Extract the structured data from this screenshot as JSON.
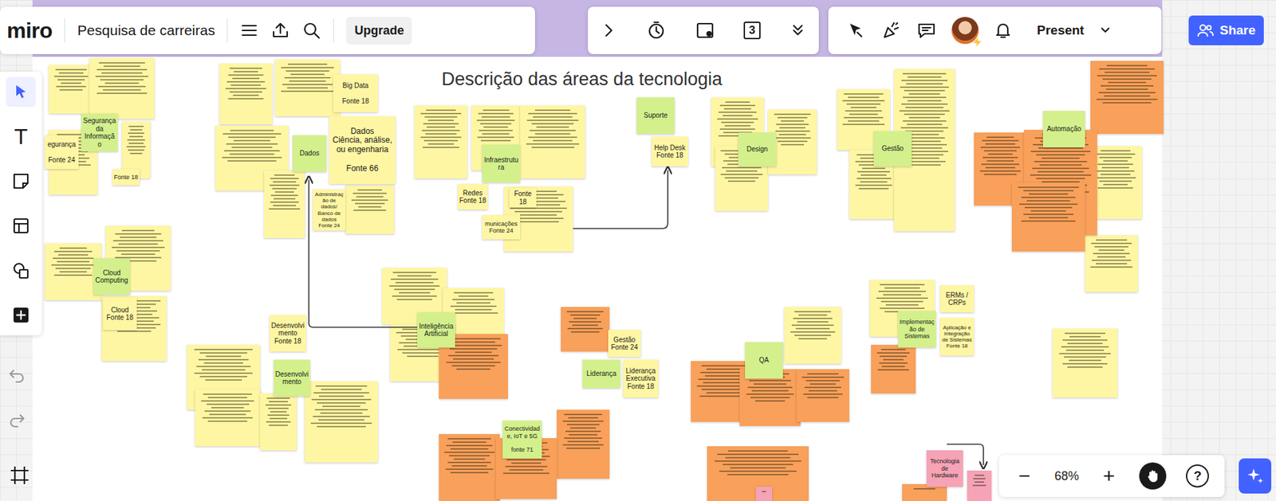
{
  "toolbar": {
    "logo": "miro",
    "board_title": "Pesquisa de carreiras",
    "upgrade": "Upgrade",
    "counter": "3",
    "present": "Present",
    "share": "Share",
    "text_tool": "T"
  },
  "frame": {
    "heading": "Descrição das áreas da tecnologia"
  },
  "notes": [
    {
      "text": "Segurança da Informação",
      "color": "#d3f08c"
    },
    {
      "text": "egurança\n\nFonte 24",
      "color": "#fff6a3"
    },
    {
      "text": "Fonte 18",
      "color": "#fff6a3"
    },
    {
      "text": "Big Data\n\nFonte 18",
      "color": "#fff6a3"
    },
    {
      "text": "Dados\nCiência, análise, ou engenharia\n\nFonte 66",
      "color": "#fff6a3"
    },
    {
      "text": "Dados",
      "color": "#d3f08c"
    },
    {
      "text": "Administração de dados/ Banco de dados\nFonte 24",
      "color": "#fff6a3"
    },
    {
      "text": "Infraestrutura",
      "color": "#d3f08c"
    },
    {
      "text": "Redes\nFonte 18",
      "color": "#fff6a3"
    },
    {
      "text": "Fonte 18",
      "color": "#fff6a3"
    },
    {
      "text": "municações\nFonte 24",
      "color": "#fff6a3"
    },
    {
      "text": "Suporte",
      "color": "#d3f08c"
    },
    {
      "text": "Help Desk\nFonte 18",
      "color": "#fff6a3"
    },
    {
      "text": "Design",
      "color": "#d3f08c"
    },
    {
      "text": "Gestão",
      "color": "#d3f08c"
    },
    {
      "text": "Automação",
      "color": "#d3f08c"
    },
    {
      "text": "Cloud Computing",
      "color": "#d3f08c"
    },
    {
      "text": "Cloud\nFonte 18",
      "color": "#fff6a3"
    },
    {
      "text": "Desenvolvimento\nFonte 18",
      "color": "#fff6a3"
    },
    {
      "text": "Desenvolvimento",
      "color": "#d3f08c"
    },
    {
      "text": "Inteligência Artificial",
      "color": "#d3f08c"
    },
    {
      "text": "Gestão\nFonte 24",
      "color": "#fff6a3"
    },
    {
      "text": "Liderança",
      "color": "#d3f08c"
    },
    {
      "text": "Liderança Executiva\nFonte 18",
      "color": "#fff6a3"
    },
    {
      "text": "Conectividade, IoT e 5G\n\nfonte 71",
      "color": "#d3f08c"
    },
    {
      "text": "QA",
      "color": "#d3f08c"
    },
    {
      "text": "Implementação de Sistemas",
      "color": "#d3f08c"
    },
    {
      "text": "ERMs / CRPs",
      "color": "#fff6a3"
    },
    {
      "text": "Aplicação e Integração de Sistemas\nFonte 18",
      "color": "#fff6a3"
    },
    {
      "text": "Tecnologia de Hardware",
      "color": "#f5a3b5"
    },
    {
      "text": "",
      "color": "#fff6a3"
    },
    {
      "text": "",
      "color": "#fff6a3"
    },
    {
      "text": "",
      "color": "#fff6a3"
    },
    {
      "text": "",
      "color": "#fff6a3"
    },
    {
      "text": "",
      "color": "#fff6a3"
    },
    {
      "text": "",
      "color": "#fff6a3"
    },
    {
      "text": "",
      "color": "#fff6a3"
    },
    {
      "text": "",
      "color": "#fff6a3"
    },
    {
      "text": "",
      "color": "#fff6a3"
    },
    {
      "text": "",
      "color": "#fff6a3"
    },
    {
      "text": "",
      "color": "#fff6a3"
    },
    {
      "text": "",
      "color": "#fff6a3"
    },
    {
      "text": "",
      "color": "#fff6a3"
    },
    {
      "text": "",
      "color": "#fff6a3"
    },
    {
      "text": "",
      "color": "#fff6a3"
    },
    {
      "text": "",
      "color": "#fff6a3"
    },
    {
      "text": "",
      "color": "#fff6a3"
    },
    {
      "text": "",
      "color": "#fff6a3"
    },
    {
      "text": "",
      "color": "#fff6a3"
    },
    {
      "text": "",
      "color": "#fff6a3"
    },
    {
      "text": "",
      "color": "#fff6a3"
    },
    {
      "text": "",
      "color": "#fff6a3"
    },
    {
      "text": "",
      "color": "#fff6a3"
    },
    {
      "text": "",
      "color": "#fff6a3"
    },
    {
      "text": "",
      "color": "#fff6a3"
    },
    {
      "text": "",
      "color": "#fff6a3"
    },
    {
      "text": "",
      "color": "#fff6a3"
    },
    {
      "text": "",
      "color": "#fff6a3"
    },
    {
      "text": "",
      "color": "#fff6a3"
    },
    {
      "text": "",
      "color": "#fff6a3"
    },
    {
      "text": "",
      "color": "#fff6a3"
    },
    {
      "text": "",
      "color": "#fff6a3"
    },
    {
      "text": "",
      "color": "#fff6a3"
    },
    {
      "text": "",
      "color": "#fff6a3"
    },
    {
      "text": "",
      "color": "#f9a05a"
    },
    {
      "text": "",
      "color": "#f9a05a"
    },
    {
      "text": "",
      "color": "#f9a05a"
    },
    {
      "text": "",
      "color": "#f9a05a"
    },
    {
      "text": "",
      "color": "#f9a05a"
    },
    {
      "text": "",
      "color": "#f9a05a"
    },
    {
      "text": "",
      "color": "#f9a05a"
    },
    {
      "text": "",
      "color": "#f9a05a"
    },
    {
      "text": "",
      "color": "#f9a05a"
    },
    {
      "text": "",
      "color": "#f9a05a"
    },
    {
      "text": "",
      "color": "#f9a05a"
    },
    {
      "text": "",
      "color": "#f9a05a"
    },
    {
      "text": "",
      "color": "#f9a05a"
    },
    {
      "text": "",
      "color": "#f9a05a"
    },
    {
      "text": "",
      "color": "#f9a05a"
    },
    {
      "text": "",
      "color": "#f5a3b5"
    },
    {
      "text": "",
      "color": "#f5a3b5"
    }
  ],
  "zoom": {
    "minus": "−",
    "level": "68%",
    "plus": "+",
    "help": "?"
  }
}
